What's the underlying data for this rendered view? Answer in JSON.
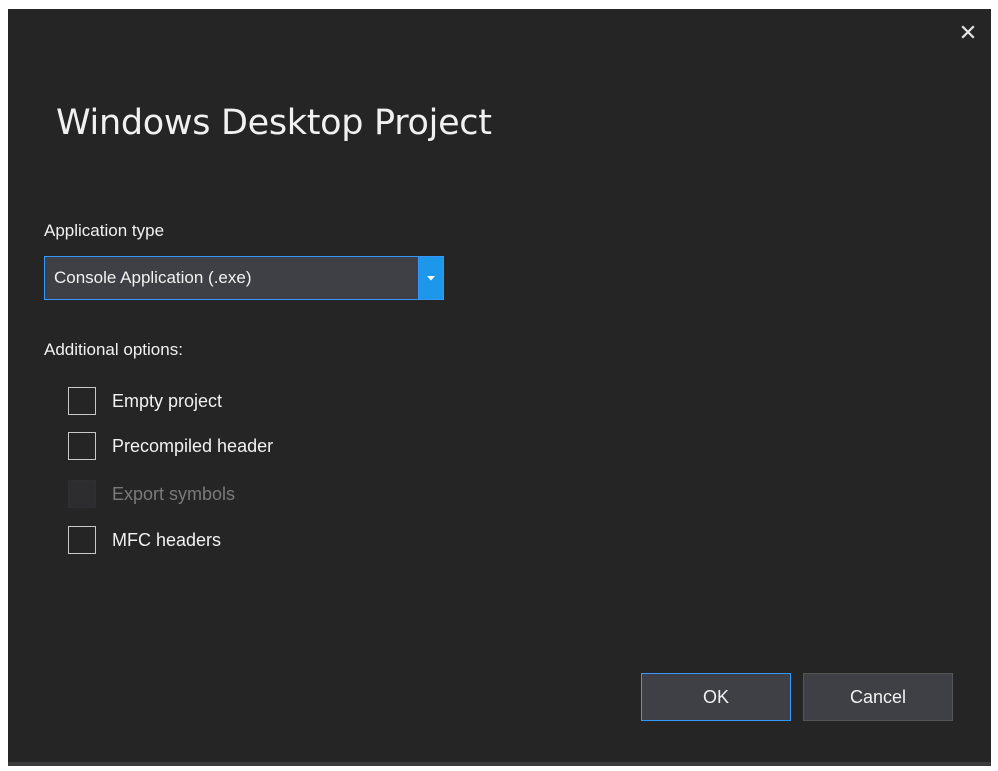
{
  "dialog": {
    "title": "Windows Desktop Project",
    "close_icon": "close-icon"
  },
  "application_type": {
    "label": "Application type",
    "selected": "Console Application (.exe)",
    "arrow_icon": "chevron-down-icon"
  },
  "additional_options": {
    "label": "Additional options:",
    "items": [
      {
        "label": "Empty project",
        "checked": false,
        "enabled": true
      },
      {
        "label": "Precompiled header",
        "checked": false,
        "enabled": true
      },
      {
        "label": "Export symbols",
        "checked": false,
        "enabled": false
      },
      {
        "label": "MFC headers",
        "checked": false,
        "enabled": true
      }
    ]
  },
  "buttons": {
    "ok_label": "OK",
    "cancel_label": "Cancel"
  },
  "colors": {
    "background": "#252526",
    "accent": "#3399ff",
    "control": "#3f3f46",
    "text": "#f1f1f1",
    "disabled_text": "#7a7a7a"
  }
}
